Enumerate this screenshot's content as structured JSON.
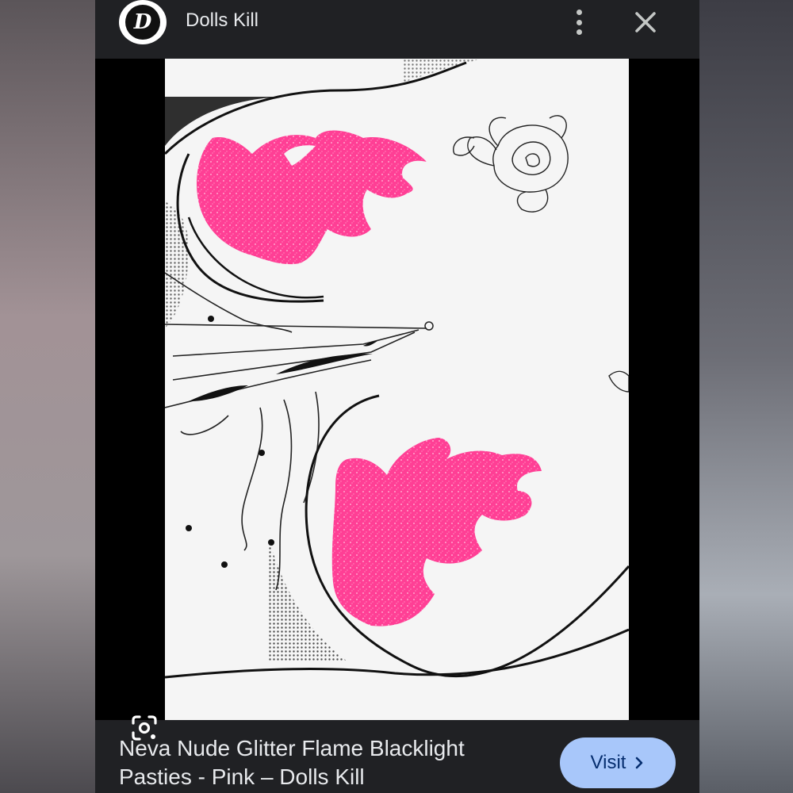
{
  "header": {
    "site_name": "Dolls Kill",
    "logo_letter": "D",
    "more_icon": "more-vert-icon",
    "close_icon": "close-icon"
  },
  "image": {
    "lens_icon": "google-lens-icon",
    "accent_pink": "#ff3f95"
  },
  "footer": {
    "caption_line1": "Neva Nude Glitter Flame Blacklight",
    "caption_line2": "Pasties - Pink – Dolls Kill",
    "visit_label": "Visit",
    "visit_icon": "chevron-right-icon",
    "visit_color": "#a8c7fa"
  }
}
